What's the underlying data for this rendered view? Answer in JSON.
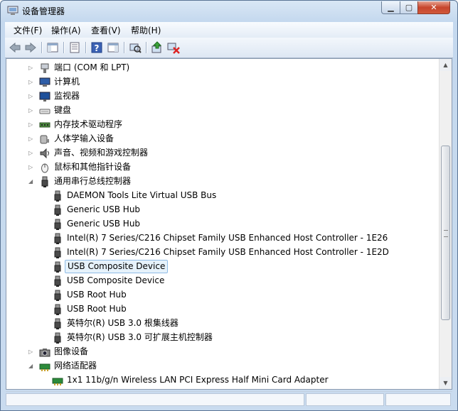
{
  "window": {
    "title": "设备管理器"
  },
  "controls": {
    "minimize": "▁",
    "maximize": "▢",
    "close": "✕"
  },
  "menu": [
    {
      "label": "文件(F)"
    },
    {
      "label": "操作(A)"
    },
    {
      "label": "查看(V)"
    },
    {
      "label": "帮助(H)"
    }
  ],
  "toolbar": [
    {
      "name": "back-arrow-icon"
    },
    {
      "name": "forward-arrow-icon"
    },
    {
      "name": "show-hide-console-tree-icon"
    },
    {
      "name": "properties-icon"
    },
    {
      "name": "help-icon"
    },
    {
      "name": "view-toggle-icon"
    },
    {
      "name": "scan-hardware-changes-icon"
    },
    {
      "name": "update-driver-icon"
    },
    {
      "name": "uninstall-device-icon"
    }
  ],
  "tree": [
    {
      "label": "端口 (COM 和 LPT)",
      "level": 0,
      "state": "collapsed",
      "icon": "port"
    },
    {
      "label": "计算机",
      "level": 0,
      "state": "collapsed",
      "icon": "computer"
    },
    {
      "label": "监视器",
      "level": 0,
      "state": "collapsed",
      "icon": "monitor"
    },
    {
      "label": "键盘",
      "level": 0,
      "state": "collapsed",
      "icon": "keyboard"
    },
    {
      "label": "内存技术驱动程序",
      "level": 0,
      "state": "collapsed",
      "icon": "memory"
    },
    {
      "label": "人体学输入设备",
      "level": 0,
      "state": "collapsed",
      "icon": "hid"
    },
    {
      "label": "声音、视频和游戏控制器",
      "level": 0,
      "state": "collapsed",
      "icon": "sound"
    },
    {
      "label": "鼠标和其他指针设备",
      "level": 0,
      "state": "collapsed",
      "icon": "mouse"
    },
    {
      "label": "通用串行总线控制器",
      "level": 0,
      "state": "expanded",
      "icon": "usb"
    },
    {
      "label": "DAEMON Tools Lite Virtual USB Bus",
      "level": 1,
      "icon": "usb"
    },
    {
      "label": "Generic USB Hub",
      "level": 1,
      "icon": "usb"
    },
    {
      "label": "Generic USB Hub",
      "level": 1,
      "icon": "usb"
    },
    {
      "label": "Intel(R) 7 Series/C216 Chipset Family USB Enhanced Host Controller - 1E26",
      "level": 1,
      "icon": "usb"
    },
    {
      "label": "Intel(R) 7 Series/C216 Chipset Family USB Enhanced Host Controller - 1E2D",
      "level": 1,
      "icon": "usb"
    },
    {
      "label": "USB Composite Device",
      "level": 1,
      "icon": "usb",
      "selected": true
    },
    {
      "label": "USB Composite Device",
      "level": 1,
      "icon": "usb"
    },
    {
      "label": "USB Root Hub",
      "level": 1,
      "icon": "usb"
    },
    {
      "label": "USB Root Hub",
      "level": 1,
      "icon": "usb"
    },
    {
      "label": "英特尔(R) USB 3.0 根集线器",
      "level": 1,
      "icon": "usb"
    },
    {
      "label": "英特尔(R) USB 3.0 可扩展主机控制器",
      "level": 1,
      "icon": "usb"
    },
    {
      "label": "图像设备",
      "level": 0,
      "state": "collapsed",
      "icon": "camera"
    },
    {
      "label": "网络适配器",
      "level": 0,
      "state": "expanded",
      "icon": "network"
    },
    {
      "label": "1x1 11b/g/n Wireless LAN PCI Express Half Mini Card Adapter",
      "level": 1,
      "icon": "network"
    }
  ]
}
